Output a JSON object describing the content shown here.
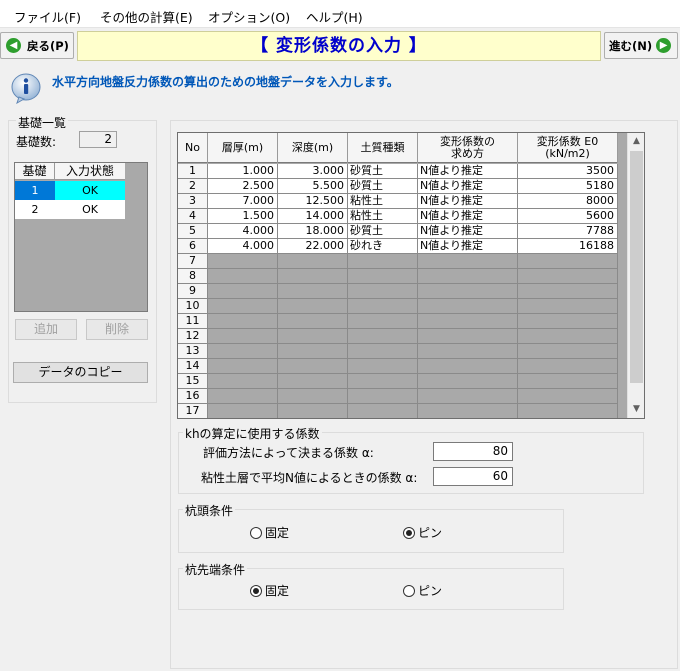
{
  "menu": [
    "ファイル(F)",
    "その他の計算(E)",
    "オプション(O)",
    "ヘルプ(H)"
  ],
  "nav": {
    "back": "戻る(P)",
    "next": "進む(N)",
    "title": "【  変形係数の入力  】"
  },
  "info": {
    "icon": "info-icon",
    "message": "水平方向地盤反力係数の算出のための地盤データを入力します。"
  },
  "ground_list": {
    "title": "基礎一覧",
    "count_label": "基礎数:",
    "count": "2",
    "headers": [
      "基礎",
      "入力状態"
    ],
    "rows": [
      {
        "base": "1",
        "state": "OK",
        "selected": true
      },
      {
        "base": "2",
        "state": "OK",
        "selected": false
      }
    ],
    "add_button": "追加",
    "delete_button": "削除",
    "copy_button": "データのコピー"
  },
  "grid": {
    "headers": [
      "No",
      "層厚(m)",
      "深度(m)",
      "土質種類",
      "変形係数の\n求め方",
      "変形係数 E0\n(kN/m2)"
    ],
    "rows": [
      {
        "no": "1",
        "thick": "1.000",
        "depth": "3.000",
        "soil": "砂質土",
        "method": "N値より推定",
        "e0": "3500"
      },
      {
        "no": "2",
        "thick": "2.500",
        "depth": "5.500",
        "soil": "砂質土",
        "method": "N値より推定",
        "e0": "5180"
      },
      {
        "no": "3",
        "thick": "7.000",
        "depth": "12.500",
        "soil": "粘性土",
        "method": "N値より推定",
        "e0": "8000"
      },
      {
        "no": "4",
        "thick": "1.500",
        "depth": "14.000",
        "soil": "粘性土",
        "method": "N値より推定",
        "e0": "5600"
      },
      {
        "no": "5",
        "thick": "4.000",
        "depth": "18.000",
        "soil": "砂質土",
        "method": "N値より推定",
        "e0": "7788"
      },
      {
        "no": "6",
        "thick": "4.000",
        "depth": "22.000",
        "soil": "砂れき",
        "method": "N値より推定",
        "e0": "16188"
      }
    ],
    "empty_rows": [
      "7",
      "8",
      "9",
      "10",
      "11",
      "12",
      "13",
      "14",
      "15",
      "16",
      "17"
    ]
  },
  "kh": {
    "title": "khの算定に使用する係数",
    "alpha1_label": "評価方法によって決まる係数 α:",
    "alpha1_value": "80",
    "alpha2_label": "粘性土層で平均N値によるときの係数 α:",
    "alpha2_value": "60"
  },
  "pile_head": {
    "title": "杭頭条件",
    "option1": "固定",
    "option2": "ピン",
    "selected": "ピン"
  },
  "pile_tip": {
    "title": "杭先端条件",
    "option1": "固定",
    "option2": "ピン",
    "selected": "固定"
  },
  "colors": {
    "title_text": "#0000cc",
    "info_text": "#0057b8",
    "selected_row": "#00ffff",
    "nav_arrow": "#2e9e2e"
  }
}
